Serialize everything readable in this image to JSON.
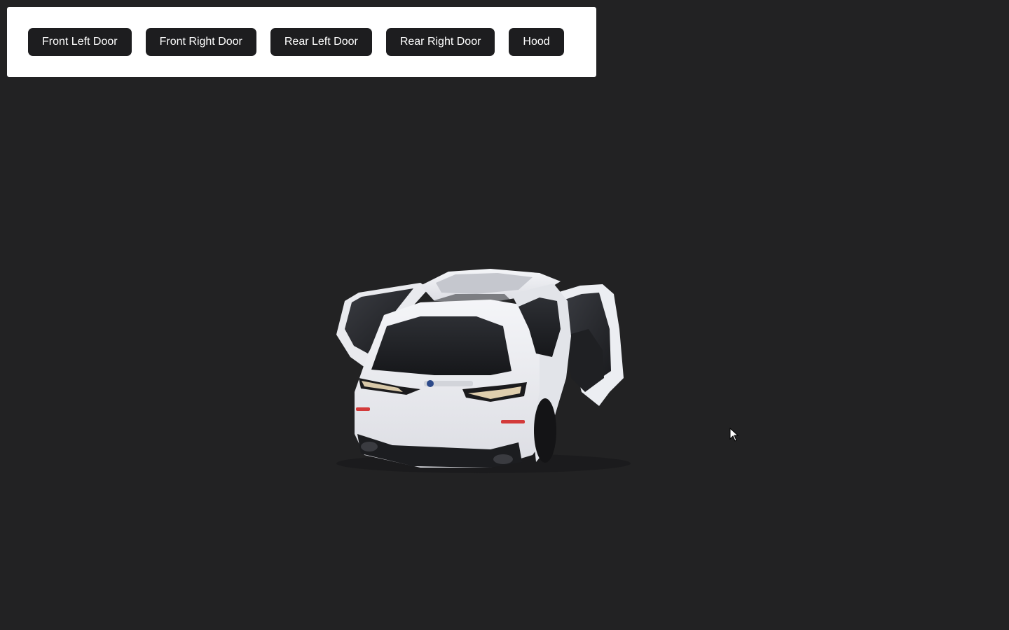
{
  "controls": {
    "buttons": [
      {
        "id": "front-left-door",
        "label": "Front Left Door"
      },
      {
        "id": "front-right-door",
        "label": "Front Right Door"
      },
      {
        "id": "rear-left-door",
        "label": "Rear Left Door"
      },
      {
        "id": "rear-right-door",
        "label": "Rear Right Door"
      },
      {
        "id": "hood",
        "label": "Hood"
      }
    ]
  },
  "scene": {
    "background": "#222223",
    "model": "white SUV with rear left and rear right doors open",
    "cursor_icon": "arrow-cursor-icon"
  },
  "colors": {
    "panel": "#ffffff",
    "button": "#1d1d1f",
    "button_text": "#ffffff"
  }
}
